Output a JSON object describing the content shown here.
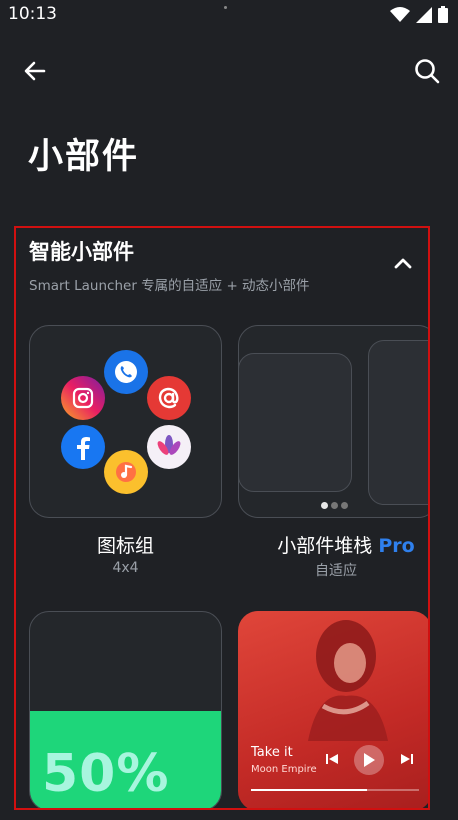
{
  "status_bar": {
    "time": "10:13"
  },
  "page": {
    "title": "小部件"
  },
  "section": {
    "title": "智能小部件",
    "subtitle": "Smart Launcher 专属的自适应 + 动态小部件"
  },
  "widgets": [
    {
      "label": "图标组",
      "sub": "4x4"
    },
    {
      "label": "小部件堆栈",
      "badge": "Pro",
      "sub": "自适应"
    },
    {
      "battery_text": "50%",
      "battery_level": 0.5
    },
    {
      "song": "Take it",
      "artist": "Moon Empire",
      "progress": 0.69
    }
  ],
  "colors": {
    "background": "#1f2125",
    "highlight_border": "#d01010",
    "pro_badge": "#2f80ed",
    "battery": "#1ed67a",
    "music_card": "#d23a30"
  },
  "icons": [
    "back-arrow-icon",
    "search-icon",
    "chevron-up-icon",
    "phone-icon",
    "instagram-icon",
    "email-icon",
    "facebook-icon",
    "flower-icon",
    "music-icon",
    "previous-icon",
    "play-icon",
    "next-icon"
  ]
}
